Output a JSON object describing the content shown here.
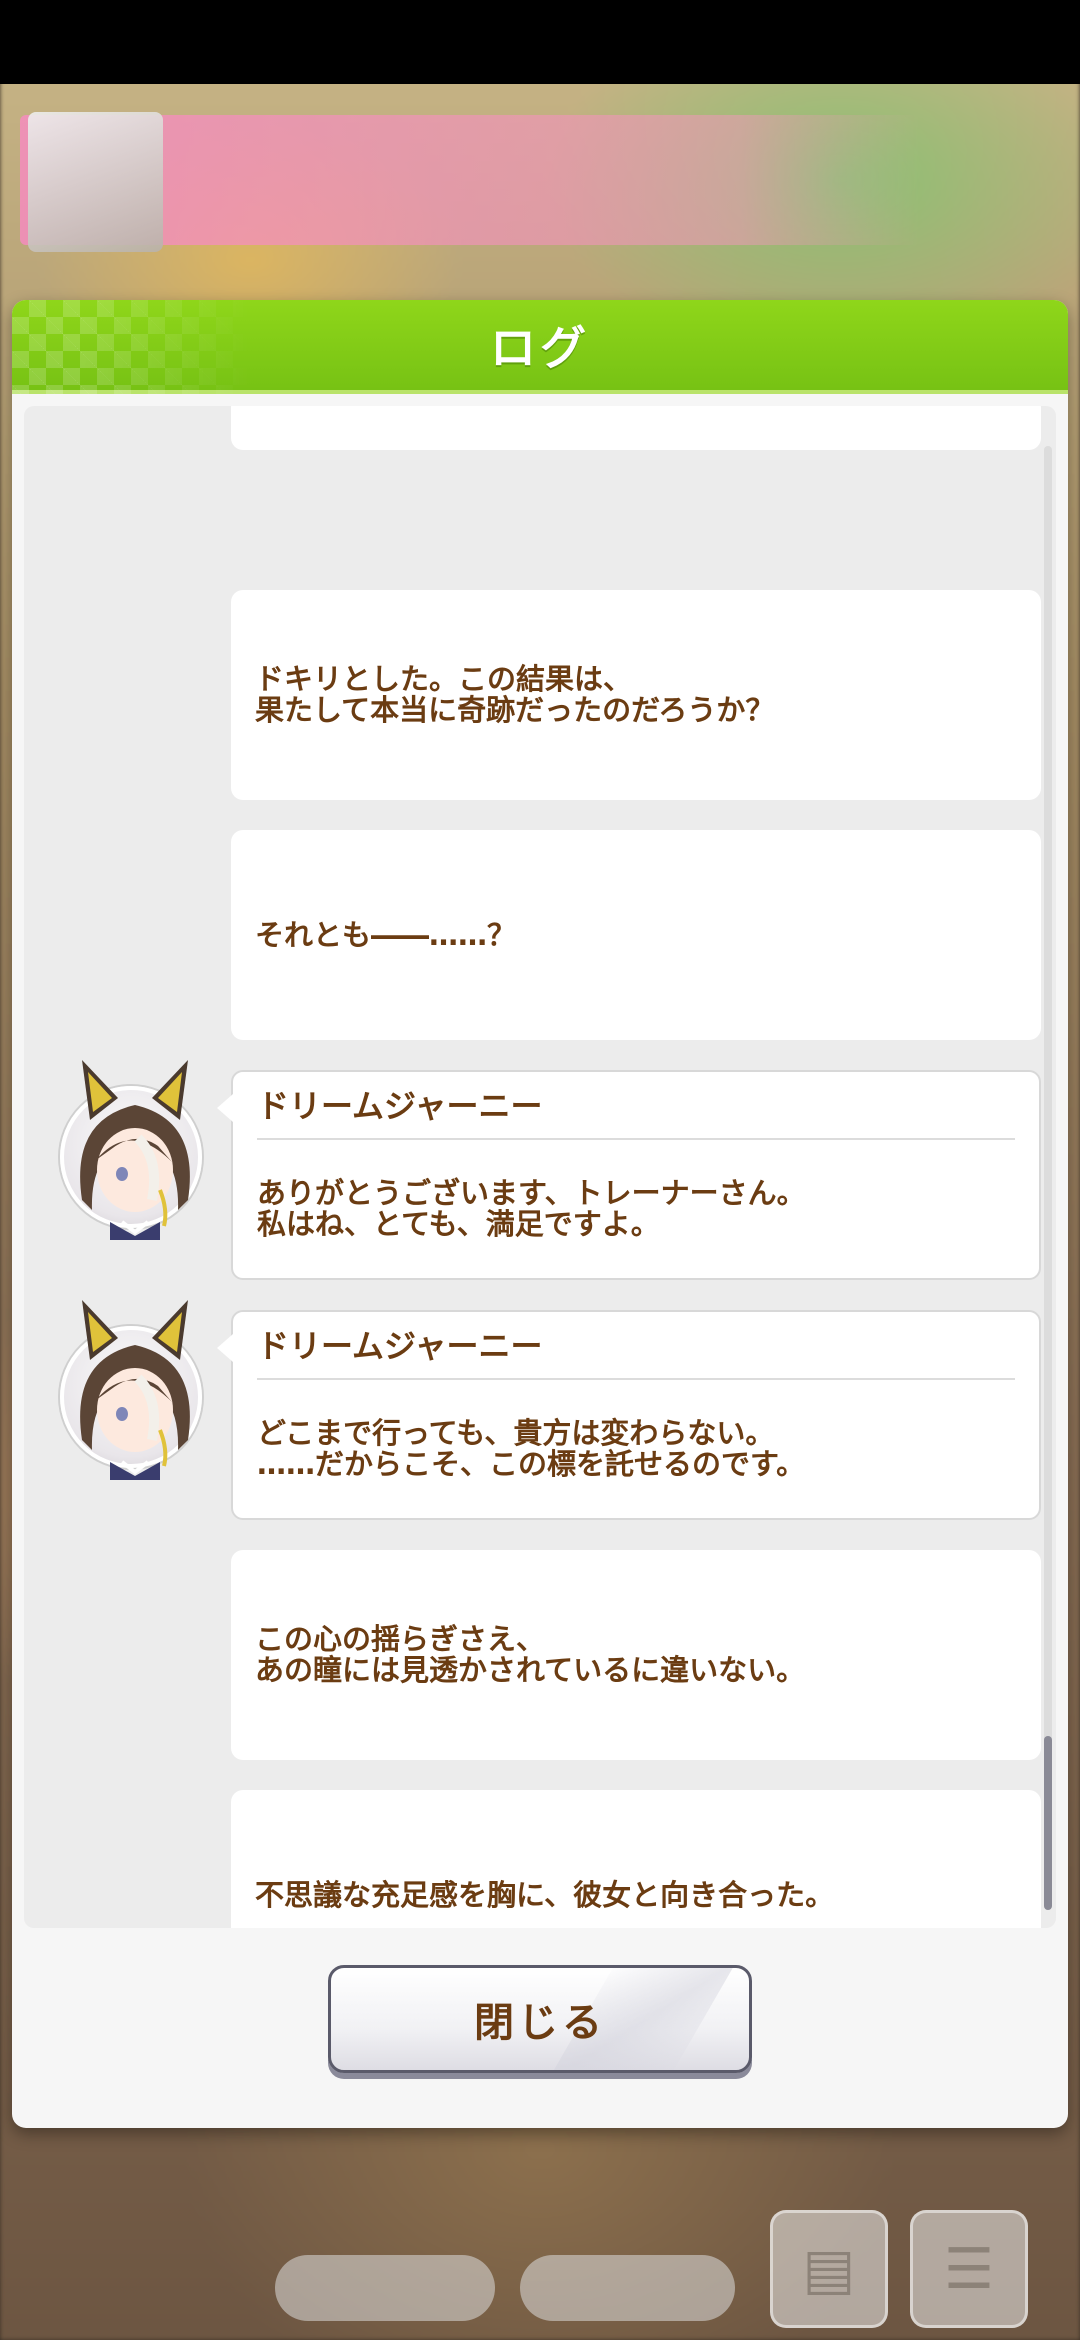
{
  "dialog": {
    "title": "ログ"
  },
  "log": {
    "entries": [
      {
        "speaker": "",
        "text": ""
      },
      {
        "speaker": "",
        "text": "ドキリとした。この結果は、\n果たして本当に奇跡だったのだろうか？"
      },
      {
        "speaker": "",
        "text": "それとも――……？"
      },
      {
        "speaker": "ドリームジャーニー",
        "text": "ありがとうございます、トレーナーさん。\n私はね、とても、満足ですよ。"
      },
      {
        "speaker": "ドリームジャーニー",
        "text": "どこまで行っても、貴方は変わらない。\n……だからこそ、この標を託せるのです。"
      },
      {
        "speaker": "",
        "text": "この心の揺らぎさえ、\nあの瞳には見透かされているに違いない。"
      },
      {
        "speaker": "",
        "text": "不思議な充足感を胸に、彼女と向き合った。"
      }
    ]
  },
  "close_button": {
    "label": "閉じる"
  },
  "colors": {
    "header_green": "#7fcc16",
    "text_brown": "#6b3c12"
  },
  "icons": {
    "avatar": "character-portrait-icon",
    "menu": "menu-icon",
    "log": "log-icon"
  }
}
